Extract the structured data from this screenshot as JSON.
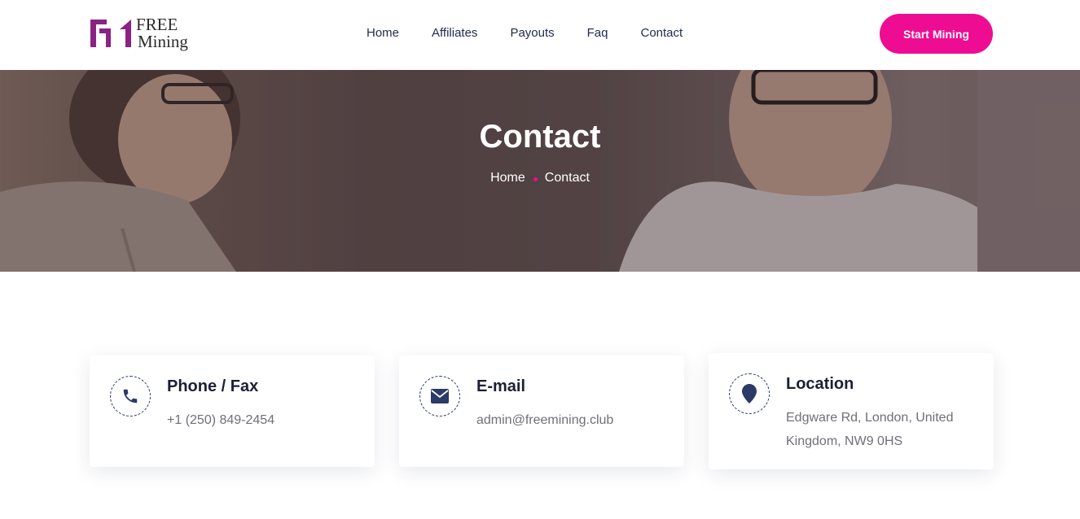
{
  "header": {
    "logo": {
      "line1": "FREE",
      "line2": "Mining"
    },
    "nav": [
      "Home",
      "Affiliates",
      "Payouts",
      "Faq",
      "Contact"
    ],
    "cta_label": "Start Mining"
  },
  "hero": {
    "title": "Contact",
    "breadcrumb": [
      "Home",
      "Contact"
    ]
  },
  "contact_cards": [
    {
      "icon": "phone-icon",
      "title": "Phone / Fax",
      "text": "+1 (250) 849-2454"
    },
    {
      "icon": "envelope-icon",
      "title": "E-mail",
      "text": "admin@freemining.club"
    },
    {
      "icon": "map-pin-icon",
      "title": "Location",
      "text": "Edgware Rd, London, United Kingdom, NW9 0HS"
    }
  ],
  "colors": {
    "accent": "#ee0c92",
    "brand": "#8b2380",
    "navy": "#2b3a66"
  }
}
